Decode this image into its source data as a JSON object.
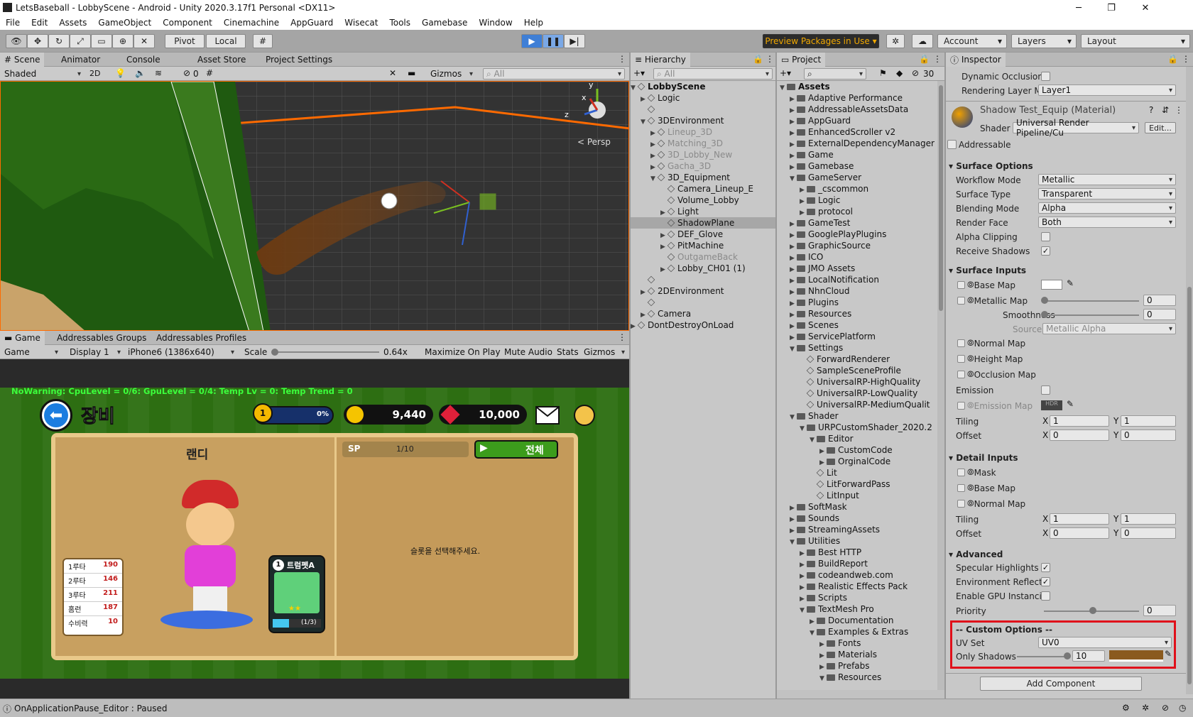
{
  "window": {
    "title": "LetsBaseball - LobbyScene - Android - Unity 2020.3.17f1 Personal <DX11>",
    "min": "─",
    "max": "❐",
    "close": "✕"
  },
  "menu": [
    "File",
    "Edit",
    "Assets",
    "GameObject",
    "Component",
    "Cinemachine",
    "AppGuard",
    "Wisecat",
    "Tools",
    "Gamebase",
    "Window",
    "Help"
  ],
  "toolbar": {
    "pivot": "Pivot",
    "local": "Local",
    "preview": "Preview Packages in Use",
    "account": "Account",
    "layers": "Layers",
    "layout": "Layout"
  },
  "scene_tabs": [
    "Scene",
    "Animator",
    "Console",
    "Asset Store",
    "Project Settings"
  ],
  "scene_bar": {
    "shaded": "Shaded",
    "mode2d": "2D",
    "fx_count": "0",
    "gizmos": "Gizmos",
    "search": "All"
  },
  "scene_view": {
    "persp": "< Persp",
    "axis_y": "y",
    "axis_x": "x",
    "axis_z": "z"
  },
  "game_tabs": [
    "Game",
    "Addressables Groups",
    "Addressables Profiles"
  ],
  "game_bar": {
    "game": "Game",
    "display": "Display 1",
    "resolution": "iPhone6 (1386x640)",
    "scale_label": "Scale",
    "scale_value": "0.64x",
    "maximize": "Maximize On Play",
    "mute": "Mute Audio",
    "stats": "Stats",
    "gizmos": "Gizmos"
  },
  "game": {
    "debug": "NoWarning: CpuLevel = 0/6: GpuLevel = 0/4: Temp Lv = 0: Temp Trend = 0",
    "title": "장비",
    "xp_percent": "0%",
    "xp_fill": 0.0,
    "coins": "9,440",
    "gems": "10,000",
    "char_name": "랜디",
    "sp_label": "SP",
    "sp_value": "1/10",
    "all_button": "전체",
    "prompt": "슬롯을 선택해주세요.",
    "item_level": "1",
    "item_name": "트럼펫A",
    "item_stars": "★★",
    "item_count": "(1/3)",
    "item_progress": 0.333,
    "stats": [
      {
        "k": "1루타",
        "v": "190"
      },
      {
        "k": "2루타",
        "v": "146"
      },
      {
        "k": "3루타",
        "v": "211"
      },
      {
        "k": "홈런",
        "v": "187"
      },
      {
        "k": "수비력",
        "v": "10"
      }
    ]
  },
  "hierarchy": {
    "title": "Hierarchy",
    "search": "All",
    "items": [
      {
        "label": "LobbyScene",
        "depth": 0,
        "arrow": "▼",
        "bold": true
      },
      {
        "label": "Logic",
        "depth": 1,
        "arrow": "▶"
      },
      {
        "label": "",
        "depth": 1,
        "arrow": ""
      },
      {
        "label": "3DEnvironment",
        "depth": 1,
        "arrow": "▼"
      },
      {
        "label": "Lineup_3D",
        "depth": 2,
        "arrow": "▶",
        "dim": true
      },
      {
        "label": "Matching_3D",
        "depth": 2,
        "arrow": "▶",
        "dim": true
      },
      {
        "label": "3D_Lobby_New",
        "depth": 2,
        "arrow": "▶",
        "dim": true
      },
      {
        "label": "Gacha_3D",
        "depth": 2,
        "arrow": "▶",
        "dim": true
      },
      {
        "label": "3D_Equipment",
        "depth": 2,
        "arrow": "▼"
      },
      {
        "label": "Camera_Lineup_E",
        "depth": 3,
        "arrow": ""
      },
      {
        "label": "Volume_Lobby",
        "depth": 3,
        "arrow": ""
      },
      {
        "label": "Light",
        "depth": 3,
        "arrow": "▶"
      },
      {
        "label": "ShadowPlane",
        "depth": 3,
        "arrow": "",
        "selected": true
      },
      {
        "label": "DEF_Glove",
        "depth": 3,
        "arrow": "▶"
      },
      {
        "label": "PitMachine",
        "depth": 3,
        "arrow": "▶"
      },
      {
        "label": "OutgameBack",
        "depth": 3,
        "arrow": "",
        "dim": true
      },
      {
        "label": "Lobby_CH01 (1)",
        "depth": 3,
        "arrow": "▶"
      },
      {
        "label": "",
        "depth": 1,
        "arrow": ""
      },
      {
        "label": "2DEnvironment",
        "depth": 1,
        "arrow": "▶"
      },
      {
        "label": "",
        "depth": 1,
        "arrow": ""
      },
      {
        "label": "Camera",
        "depth": 1,
        "arrow": "▶"
      },
      {
        "label": "DontDestroyOnLoad",
        "depth": 0,
        "arrow": "▶"
      }
    ]
  },
  "project": {
    "title": "Project",
    "count": "30",
    "items": [
      {
        "label": "Assets",
        "depth": 0,
        "arrow": "▼",
        "bold": true
      },
      {
        "label": "Adaptive Performance",
        "depth": 1,
        "arrow": "▶"
      },
      {
        "label": "AddressableAssetsData",
        "depth": 1,
        "arrow": "▶"
      },
      {
        "label": "AppGuard",
        "depth": 1,
        "arrow": "▶"
      },
      {
        "label": "EnhancedScroller v2",
        "depth": 1,
        "arrow": "▶"
      },
      {
        "label": "ExternalDependencyManager",
        "depth": 1,
        "arrow": "▶"
      },
      {
        "label": "Game",
        "depth": 1,
        "arrow": "▶"
      },
      {
        "label": "Gamebase",
        "depth": 1,
        "arrow": "▶"
      },
      {
        "label": "GameServer",
        "depth": 1,
        "arrow": "▼"
      },
      {
        "label": "_cscommon",
        "depth": 2,
        "arrow": "▶"
      },
      {
        "label": "Logic",
        "depth": 2,
        "arrow": "▶"
      },
      {
        "label": "protocol",
        "depth": 2,
        "arrow": "▶"
      },
      {
        "label": "GameTest",
        "depth": 1,
        "arrow": "▶"
      },
      {
        "label": "GooglePlayPlugins",
        "depth": 1,
        "arrow": "▶"
      },
      {
        "label": "GraphicSource",
        "depth": 1,
        "arrow": "▶"
      },
      {
        "label": "ICO",
        "depth": 1,
        "arrow": "▶"
      },
      {
        "label": "JMO Assets",
        "depth": 1,
        "arrow": "▶"
      },
      {
        "label": "LocalNotification",
        "depth": 1,
        "arrow": "▶"
      },
      {
        "label": "NhnCloud",
        "depth": 1,
        "arrow": "▶"
      },
      {
        "label": "Plugins",
        "depth": 1,
        "arrow": "▶"
      },
      {
        "label": "Resources",
        "depth": 1,
        "arrow": "▶"
      },
      {
        "label": "Scenes",
        "depth": 1,
        "arrow": "▶"
      },
      {
        "label": "ServicePlatform",
        "depth": 1,
        "arrow": "▶"
      },
      {
        "label": "Settings",
        "depth": 1,
        "arrow": "▼"
      },
      {
        "label": "ForwardRenderer",
        "depth": 2,
        "arrow": "",
        "file": true
      },
      {
        "label": "SampleSceneProfile",
        "depth": 2,
        "arrow": "",
        "file": true
      },
      {
        "label": "UniversalRP-HighQuality",
        "depth": 2,
        "arrow": "",
        "file": true
      },
      {
        "label": "UniversalRP-LowQuality",
        "depth": 2,
        "arrow": "",
        "file": true
      },
      {
        "label": "UniversalRP-MediumQualit",
        "depth": 2,
        "arrow": "",
        "file": true
      },
      {
        "label": "Shader",
        "depth": 1,
        "arrow": "▼"
      },
      {
        "label": "URPCustomShader_2020.2",
        "depth": 2,
        "arrow": "▼"
      },
      {
        "label": "Editor",
        "depth": 3,
        "arrow": "▼"
      },
      {
        "label": "CustomCode",
        "depth": 4,
        "arrow": "▶"
      },
      {
        "label": "OrginalCode",
        "depth": 4,
        "arrow": "▶"
      },
      {
        "label": "Lit",
        "depth": 3,
        "arrow": "",
        "file": true
      },
      {
        "label": "LitForwardPass",
        "depth": 3,
        "arrow": "",
        "file": true
      },
      {
        "label": "LitInput",
        "depth": 3,
        "arrow": "",
        "file": true
      },
      {
        "label": "SoftMask",
        "depth": 1,
        "arrow": "▶"
      },
      {
        "label": "Sounds",
        "depth": 1,
        "arrow": "▶"
      },
      {
        "label": "StreamingAssets",
        "depth": 1,
        "arrow": "▶"
      },
      {
        "label": "Utilities",
        "depth": 1,
        "arrow": "▼"
      },
      {
        "label": "Best HTTP",
        "depth": 2,
        "arrow": "▶"
      },
      {
        "label": "BuildReport",
        "depth": 2,
        "arrow": "▶"
      },
      {
        "label": "codeandweb.com",
        "depth": 2,
        "arrow": "▶"
      },
      {
        "label": "Realistic Effects Pack",
        "depth": 2,
        "arrow": "▶"
      },
      {
        "label": "Scripts",
        "depth": 2,
        "arrow": "▶"
      },
      {
        "label": "TextMesh Pro",
        "depth": 2,
        "arrow": "▼"
      },
      {
        "label": "Documentation",
        "depth": 3,
        "arrow": "▶"
      },
      {
        "label": "Examples & Extras",
        "depth": 3,
        "arrow": "▼"
      },
      {
        "label": "Fonts",
        "depth": 4,
        "arrow": "▶"
      },
      {
        "label": "Materials",
        "depth": 4,
        "arrow": "▶"
      },
      {
        "label": "Prefabs",
        "depth": 4,
        "arrow": "▶"
      },
      {
        "label": "Resources",
        "depth": 4,
        "arrow": "▼"
      }
    ]
  },
  "inspector": {
    "title": "Inspector",
    "dynamic_occlusion": "Dynamic Occlusion",
    "rendering_layer": "Rendering Layer M",
    "rendering_layer_value": "Layer1",
    "material": "Shadow Test_Equip (Material)",
    "shader_label": "Shader",
    "shader_value": "Universal Render Pipeline/Cu",
    "edit": "Edit...",
    "addressable": "Addressable",
    "surface_options": "Surface Options",
    "workflow": "Workflow Mode",
    "workflow_v": "Metallic",
    "surface_type": "Surface Type",
    "surface_type_v": "Transparent",
    "blending": "Blending Mode",
    "blending_v": "Alpha",
    "render_face": "Render Face",
    "render_face_v": "Both",
    "alpha_clip": "Alpha Clipping",
    "receive_shadows": "Receive Shadows",
    "surface_inputs": "Surface Inputs",
    "base_map": "Base Map",
    "metallic_map": "Metallic Map",
    "metallic_v": "0",
    "smoothness": "Smoothness",
    "smoothness_v": "0",
    "source": "Source",
    "source_v": "Metallic Alpha",
    "normal_map": "Normal Map",
    "height_map": "Height Map",
    "occlusion_map": "Occlusion Map",
    "emission": "Emission",
    "emission_map": "Emission Map",
    "hdr": "HDR",
    "tiling": "Tiling",
    "offset": "Offset",
    "x": "X",
    "y": "Y",
    "one": "1",
    "zero": "0",
    "detail_inputs": "Detail Inputs",
    "mask": "Mask",
    "d_base_map": "Base Map",
    "d_normal_map": "Normal Map",
    "advanced": "Advanced",
    "specular": "Specular Highlights",
    "env_refl": "Environment Reflectic",
    "gpu_inst": "Enable GPU Instancin",
    "priority": "Priority",
    "priority_v": "0",
    "custom": "-- Custom Options --",
    "uv_set": "UV Set",
    "uv_set_v": "UV0",
    "only_shadows": "Only Shadows",
    "only_shadows_v": "10",
    "add_component": "Add Component"
  },
  "statusbar": {
    "text": "OnApplicationPause_Editor : Paused"
  },
  "colors": {
    "highlight": "#e0101a",
    "orange": "#ff6a00",
    "field": "#2d6e12"
  }
}
